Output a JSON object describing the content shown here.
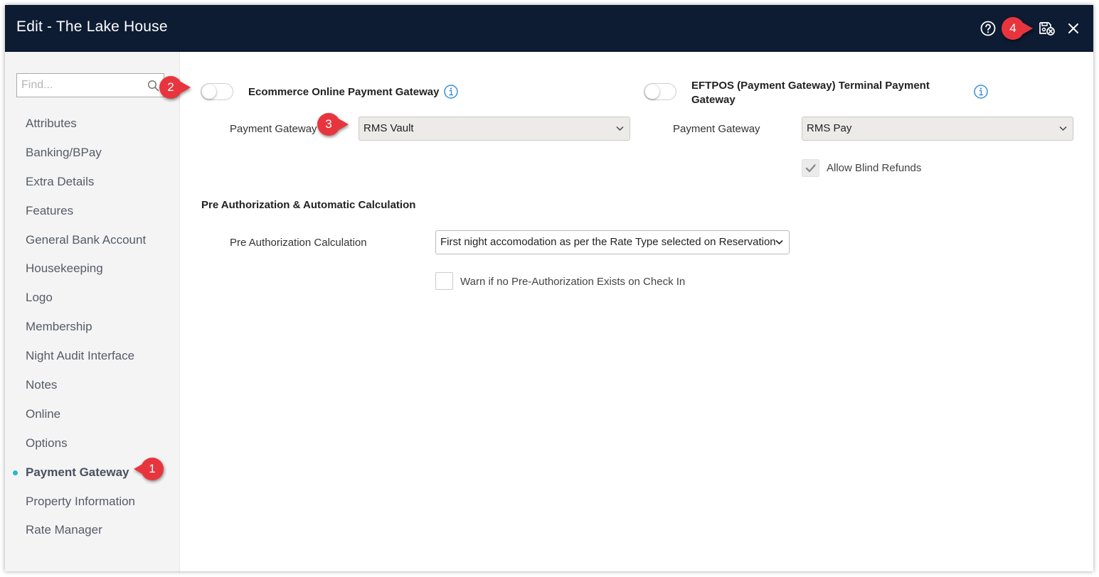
{
  "window": {
    "title": "Edit - The Lake House",
    "help_icon": "question-circle-icon",
    "save_icon": "save-close-icon",
    "close_icon": "close-icon"
  },
  "sidebar": {
    "search_placeholder": "Find...",
    "search_value": "",
    "items": [
      {
        "label": "Attributes",
        "active": false
      },
      {
        "label": "Banking/BPay",
        "active": false
      },
      {
        "label": "Extra Details",
        "active": false
      },
      {
        "label": "Features",
        "active": false
      },
      {
        "label": "General Bank Account",
        "active": false
      },
      {
        "label": "Housekeeping",
        "active": false
      },
      {
        "label": "Logo",
        "active": false
      },
      {
        "label": "Membership",
        "active": false
      },
      {
        "label": "Night Audit Interface",
        "active": false
      },
      {
        "label": "Notes",
        "active": false
      },
      {
        "label": "Online",
        "active": false
      },
      {
        "label": "Options",
        "active": false
      },
      {
        "label": "Payment Gateway",
        "active": true
      },
      {
        "label": "Property Information",
        "active": false
      },
      {
        "label": "Rate Manager",
        "active": false
      }
    ]
  },
  "ecommerce": {
    "label": "Ecommerce Online Payment Gateway",
    "enabled": false,
    "gateway_label": "Payment Gateway",
    "gateway_value": "RMS Vault"
  },
  "eftpos": {
    "label_line1": "EFTPOS (Payment Gateway) Terminal Payment",
    "label_line2": "Gateway",
    "enabled": false,
    "gateway_label": "Payment Gateway",
    "gateway_value": "RMS Pay",
    "blind_refunds_label": "Allow Blind Refunds",
    "blind_refunds_checked": true
  },
  "preauth": {
    "section_title": "Pre Authorization & Automatic Calculation",
    "calc_label": "Pre Authorization Calculation",
    "calc_value": "First night accomodation as per the Rate Type selected on Reservation",
    "warn_label": "Warn if no Pre-Authorization Exists on Check In",
    "warn_checked": false
  },
  "callouts": [
    "1",
    "2",
    "3",
    "4"
  ],
  "colors": {
    "titlebar": "#0d1b33",
    "callout": "#e8353d",
    "active_dot": "#2ab7c9",
    "info": "#3b8fd9"
  }
}
